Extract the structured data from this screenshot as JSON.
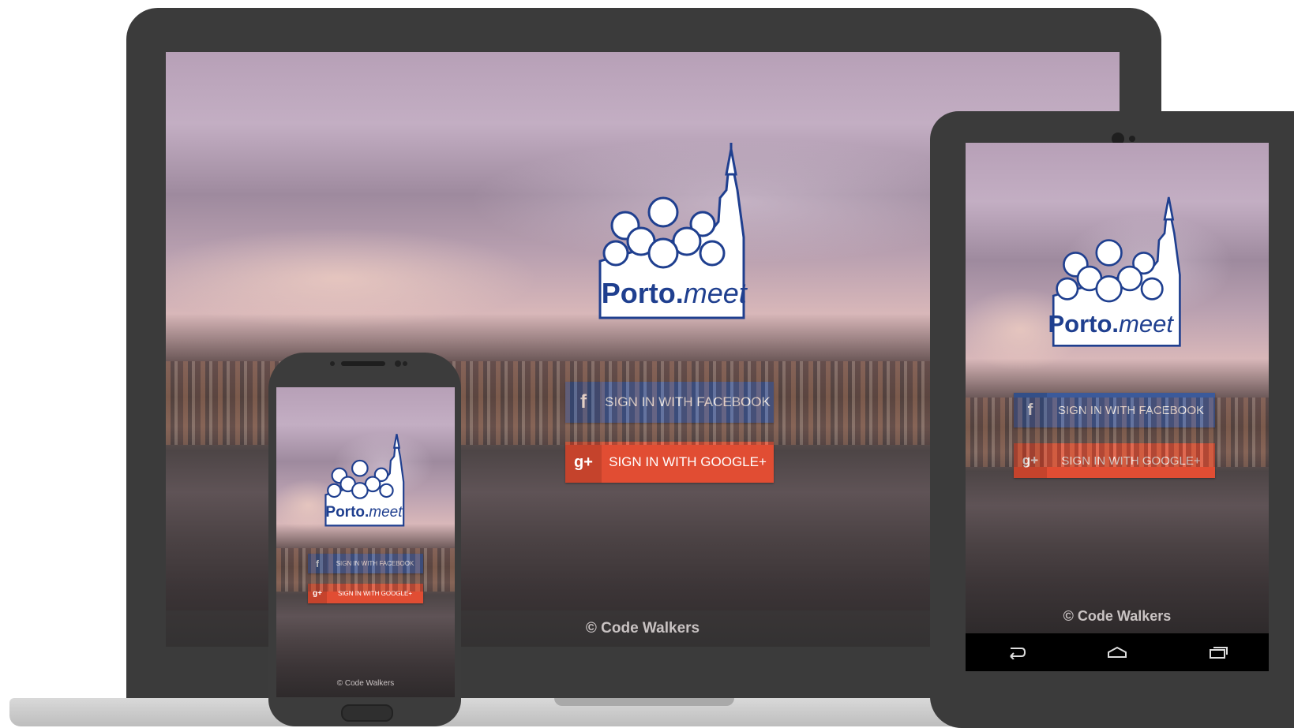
{
  "brand": {
    "name_main": "Porto.",
    "name_italic": "meet",
    "primary_color": "#1f3f8f",
    "facebook_color": "#3b5a9b",
    "google_color": "#e14d33"
  },
  "buttons": {
    "facebook_label": "SIGN IN WITH FACEBOOK",
    "facebook_icon": "f",
    "google_label": "SIGN IN WITH GOOGLE+",
    "google_icon": "g+"
  },
  "phone_buttons": {
    "facebook_label": "SIGN IN WITH FACEBOOK",
    "google_label": "SIGN IN WITH GOOGLE+"
  },
  "footer": {
    "copyright": "© Code Walkers"
  },
  "icons": {
    "facebook": "facebook-icon",
    "google": "google-plus-icon",
    "back": "back-icon",
    "home": "home-icon",
    "recents": "recents-icon"
  }
}
